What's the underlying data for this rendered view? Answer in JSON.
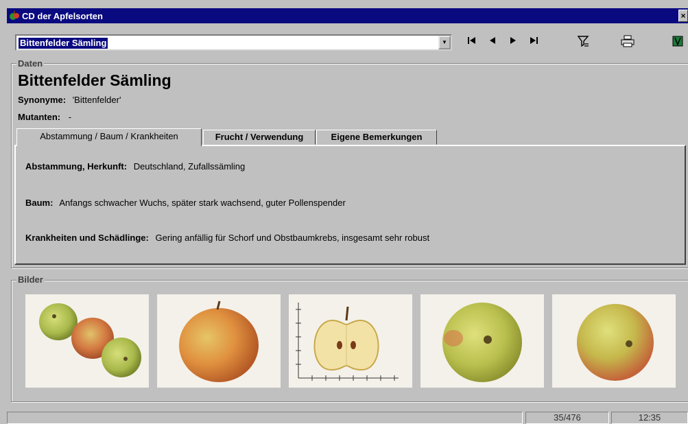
{
  "window": {
    "title": "CD der Apfelsorten",
    "close_label": "×"
  },
  "toolbar": {
    "selected_variety": "Bittenfelder Sämling",
    "combo_arrow": "▼",
    "nav_first": "|◀",
    "nav_prev": "◀",
    "nav_next": "▶",
    "nav_last": "▶|"
  },
  "daten": {
    "label": "Daten",
    "name": "Bittenfelder Sämling",
    "synonyme_label": "Synonyme:",
    "synonyme_value": "'Bittenfelder'",
    "mutanten_label": "Mutanten:",
    "mutanten_value": "-"
  },
  "tabs": [
    {
      "label": "Abstammung / Baum / Krankheiten"
    },
    {
      "label": "Frucht / Verwendung"
    },
    {
      "label": "Eigene Bemerkungen"
    }
  ],
  "details": {
    "abstammung_label": "Abstammung, Herkunft:",
    "abstammung_value": "Deutschland, Zufallssämling",
    "baum_label": "Baum:",
    "baum_value": "Anfangs schwacher Wuchs, später stark wachsend, guter Pollenspender",
    "krankheiten_label": "Krankheiten und Schädlinge:",
    "krankheiten_value": "Gering anfällig für Schorf und Obstbaumkrebs, insgesamt sehr robust"
  },
  "bilder": {
    "label": "Bilder"
  },
  "status": {
    "record": "35/476",
    "time": "12:35"
  },
  "colors": {
    "titlebar": "#0a0a80",
    "chrome": "#c0c0c0"
  },
  "icons": [
    "app-icon",
    "close-icon",
    "dropdown-icon",
    "first-record-icon",
    "previous-record-icon",
    "next-record-icon",
    "last-record-icon",
    "filter-icon",
    "print-icon",
    "book-icon"
  ]
}
